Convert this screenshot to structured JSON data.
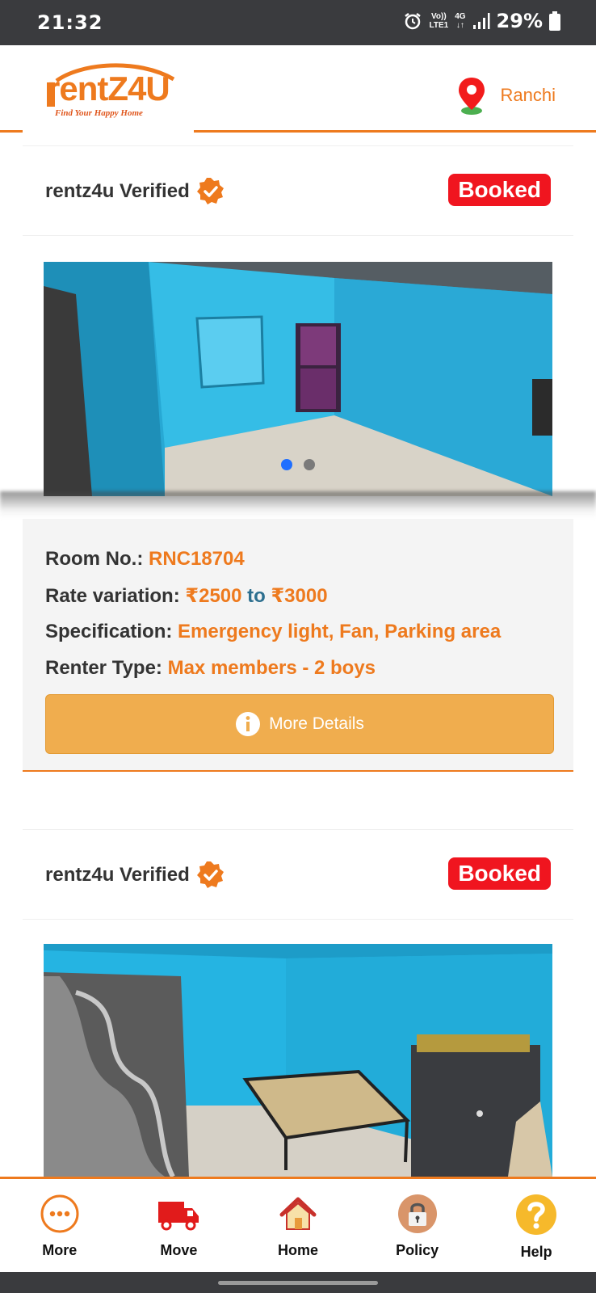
{
  "status_bar": {
    "time": "21:32",
    "network_top": "Vo))",
    "network_bottom": "LTE1",
    "net_type": "4G",
    "battery": "29%"
  },
  "header": {
    "logo_text": "rentZ4U",
    "logo_tagline": "Find Your Happy Home",
    "location_icon": "map-pin-icon",
    "city": "Ranchi"
  },
  "listings": [
    {
      "verified_label": "rentz4u Verified",
      "status_badge": "Booked",
      "carousel_dots": 2,
      "active_dot": 0,
      "room_label": "Room No.:",
      "room_no": "RNC18704",
      "rate_label": "Rate variation:",
      "rate_min": "₹2500",
      "rate_to": "to",
      "rate_max": "₹3000",
      "spec_label": "Specification:",
      "spec_value": "Emergency light, Fan, Parking area",
      "renter_label": "Renter Type:",
      "renter_value": "Max members - 2 boys",
      "button_label": "More Details"
    },
    {
      "verified_label": "rentz4u Verified",
      "status_badge": "Booked"
    }
  ],
  "bottom_nav": {
    "items": [
      {
        "label": "More",
        "icon": "more-dots-icon"
      },
      {
        "label": "Move",
        "icon": "truck-icon"
      },
      {
        "label": "Home",
        "icon": "home-icon"
      },
      {
        "label": "Policy",
        "icon": "lock-icon"
      },
      {
        "label": "Help",
        "icon": "question-icon"
      }
    ]
  },
  "colors": {
    "accent": "#ee7a1e",
    "booked": "#f0151f",
    "button": "#f0ad4e",
    "wall": "#2fb4de"
  }
}
